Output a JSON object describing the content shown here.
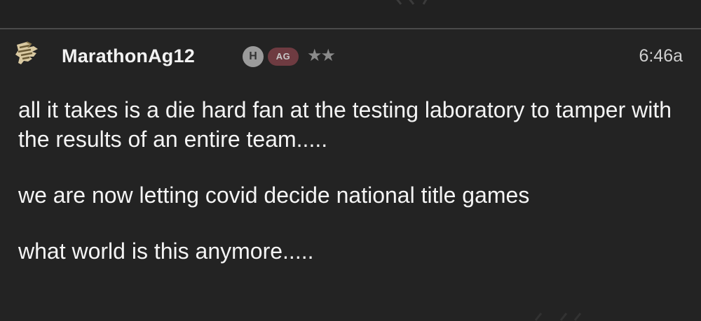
{
  "post": {
    "username": "MarathonAg12",
    "badge_h": "H",
    "badge_ag": "AG",
    "stars": "★★",
    "time": "6:46a",
    "paragraphs": [
      "all it takes is a die hard fan at the testing laboratory to tamper with the results of an entire team.....",
      "we are now letting covid decide national title games",
      "what world is this anymore....."
    ]
  },
  "colors": {
    "background": "#232323",
    "divider": "#4a4a4a",
    "text": "#f4f4f4",
    "badge_h": "#9b9b9b",
    "badge_ag": "#6e3b41"
  },
  "icons": {
    "avatar": "thumbs-up-hand-icon"
  }
}
